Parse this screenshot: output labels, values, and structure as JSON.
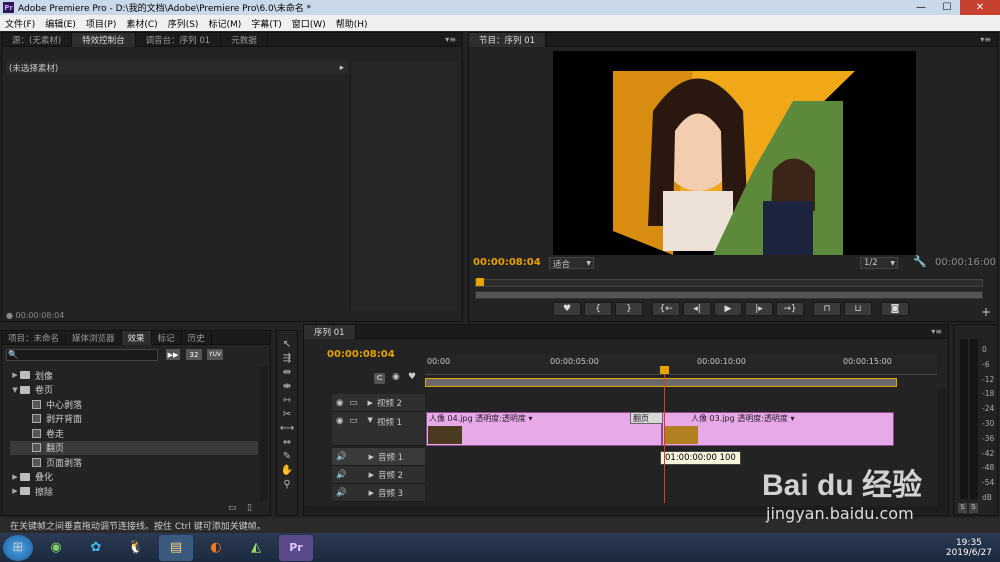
{
  "titlebar": {
    "app_icon": "Pr",
    "title": "Adobe Premiere Pro - D:\\我的文档\\Adobe\\Premiere Pro\\6.0\\未命名 *",
    "min": "—",
    "max": "☐",
    "close": "✕"
  },
  "menu": [
    "文件(F)",
    "编辑(E)",
    "项目(P)",
    "素材(C)",
    "序列(S)",
    "标记(M)",
    "字幕(T)",
    "窗口(W)",
    "帮助(H)"
  ],
  "source_panel": {
    "tabs": [
      "源：(无素材)",
      "特效控制台",
      "调音台：序列 01",
      "元数据"
    ],
    "active_tab": 1,
    "header": "(未选择素材)",
    "timecode": "00:00:08:04"
  },
  "program_panel": {
    "tab": "节目：序列 01",
    "timecode": "00:00:08:04",
    "fit": "适合",
    "resolution": "1/2",
    "duration": "00:00:16:00"
  },
  "project_panel": {
    "tabs": [
      "项目：未命名",
      "媒体浏览器",
      "效果",
      "标记",
      "历史"
    ],
    "active_tab": 2,
    "search_value": "",
    "badges": [
      "32",
      "YUV"
    ],
    "tree": [
      {
        "label": "划像",
        "type": "folder",
        "expanded": false,
        "level": 0
      },
      {
        "label": "卷页",
        "type": "folder",
        "expanded": true,
        "level": 0
      },
      {
        "label": "中心剥落",
        "type": "effect",
        "level": 1
      },
      {
        "label": "剥开背面",
        "type": "effect",
        "level": 1
      },
      {
        "label": "卷走",
        "type": "effect",
        "level": 1
      },
      {
        "label": "翻页",
        "type": "effect",
        "level": 1,
        "selected": true
      },
      {
        "label": "页面剥落",
        "type": "effect",
        "level": 1
      },
      {
        "label": "叠化",
        "type": "folder",
        "expanded": false,
        "level": 0
      },
      {
        "label": "擦除",
        "type": "folder",
        "expanded": false,
        "level": 0
      }
    ]
  },
  "timeline": {
    "tab": "序列 01",
    "timecode": "00:00:08:04",
    "ruler": [
      "00:00",
      "00:00:05:00",
      "00:00:10:00",
      "00:00:15:00"
    ],
    "tracks": [
      {
        "name": "视频 2",
        "kind": "video"
      },
      {
        "name": "视频 1",
        "kind": "video"
      },
      {
        "name": "音频 1",
        "kind": "audio"
      },
      {
        "name": "音频 2",
        "kind": "audio"
      },
      {
        "name": "音频 3",
        "kind": "audio"
      }
    ],
    "clips": [
      {
        "name": "人像 04.jpg",
        "fx": "透明度:透明度 ▾"
      },
      {
        "name": "翻页",
        "fx": ""
      },
      {
        "name": "人像 03.jpg",
        "fx": "透明度:透明度 ▾"
      }
    ],
    "tooltip": "01:00:00:00  100"
  },
  "meter": {
    "labels": [
      "0",
      "-6",
      "-12",
      "-18",
      "-24",
      "-30",
      "-36",
      "-42",
      "-48",
      "-54",
      "dB"
    ],
    "solo": "S"
  },
  "status": "在关键帧之间垂直拖动调节连接线。按住 Ctrl 键可添加关键帧。",
  "watermark": {
    "brand": "Bai du 经验",
    "url": "jingyan.baidu.com"
  },
  "taskbar": {
    "time": "19:35",
    "date": "2019/6/27"
  },
  "colors": {
    "accent": "#e8a200",
    "clip": "#e7a9e8",
    "playhead": "#e03a1a"
  }
}
